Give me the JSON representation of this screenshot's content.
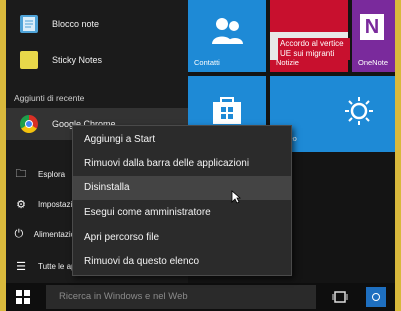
{
  "start_menu": {
    "apps": [
      {
        "label": "Blocco note",
        "icon": "notepad-icon"
      },
      {
        "label": "Sticky Notes",
        "icon": "sticky-notes-icon"
      }
    ],
    "recent_section_label": "Aggiunti di recente",
    "recent_apps": [
      {
        "label": "Google Chrome",
        "icon": "chrome-icon"
      }
    ],
    "side_items": [
      {
        "label": "Esplora",
        "icon": "folder-icon"
      },
      {
        "label": "Impostazioni",
        "icon": "gear-icon"
      },
      {
        "label": "Alimentazione",
        "icon": "power-icon"
      },
      {
        "label": "Tutte le app",
        "icon": "apps-list-icon"
      }
    ]
  },
  "tiles": {
    "contatti": {
      "label": "Contatti",
      "color": "#1e8ad6"
    },
    "notizie": {
      "label": "Notizie",
      "headline": "Accordo al vertice UE sui migranti",
      "color": "#c8102e"
    },
    "onenote": {
      "label": "OneNote",
      "color": "#7a2a9c"
    },
    "store": {
      "color": "#1e8ad6"
    },
    "meteo": {
      "label": "Meteo",
      "color": "#1e8ad6"
    }
  },
  "context_menu": {
    "items": [
      "Aggiungi a Start",
      "Rimuovi dalla barra delle applicazioni",
      "Disinstalla",
      "Esegui come amministratore",
      "Apri percorso file",
      "Rimuovi da questo elenco"
    ],
    "hovered_index": 2
  },
  "taskbar": {
    "search_placeholder": "Ricerca in Windows e nel Web"
  }
}
